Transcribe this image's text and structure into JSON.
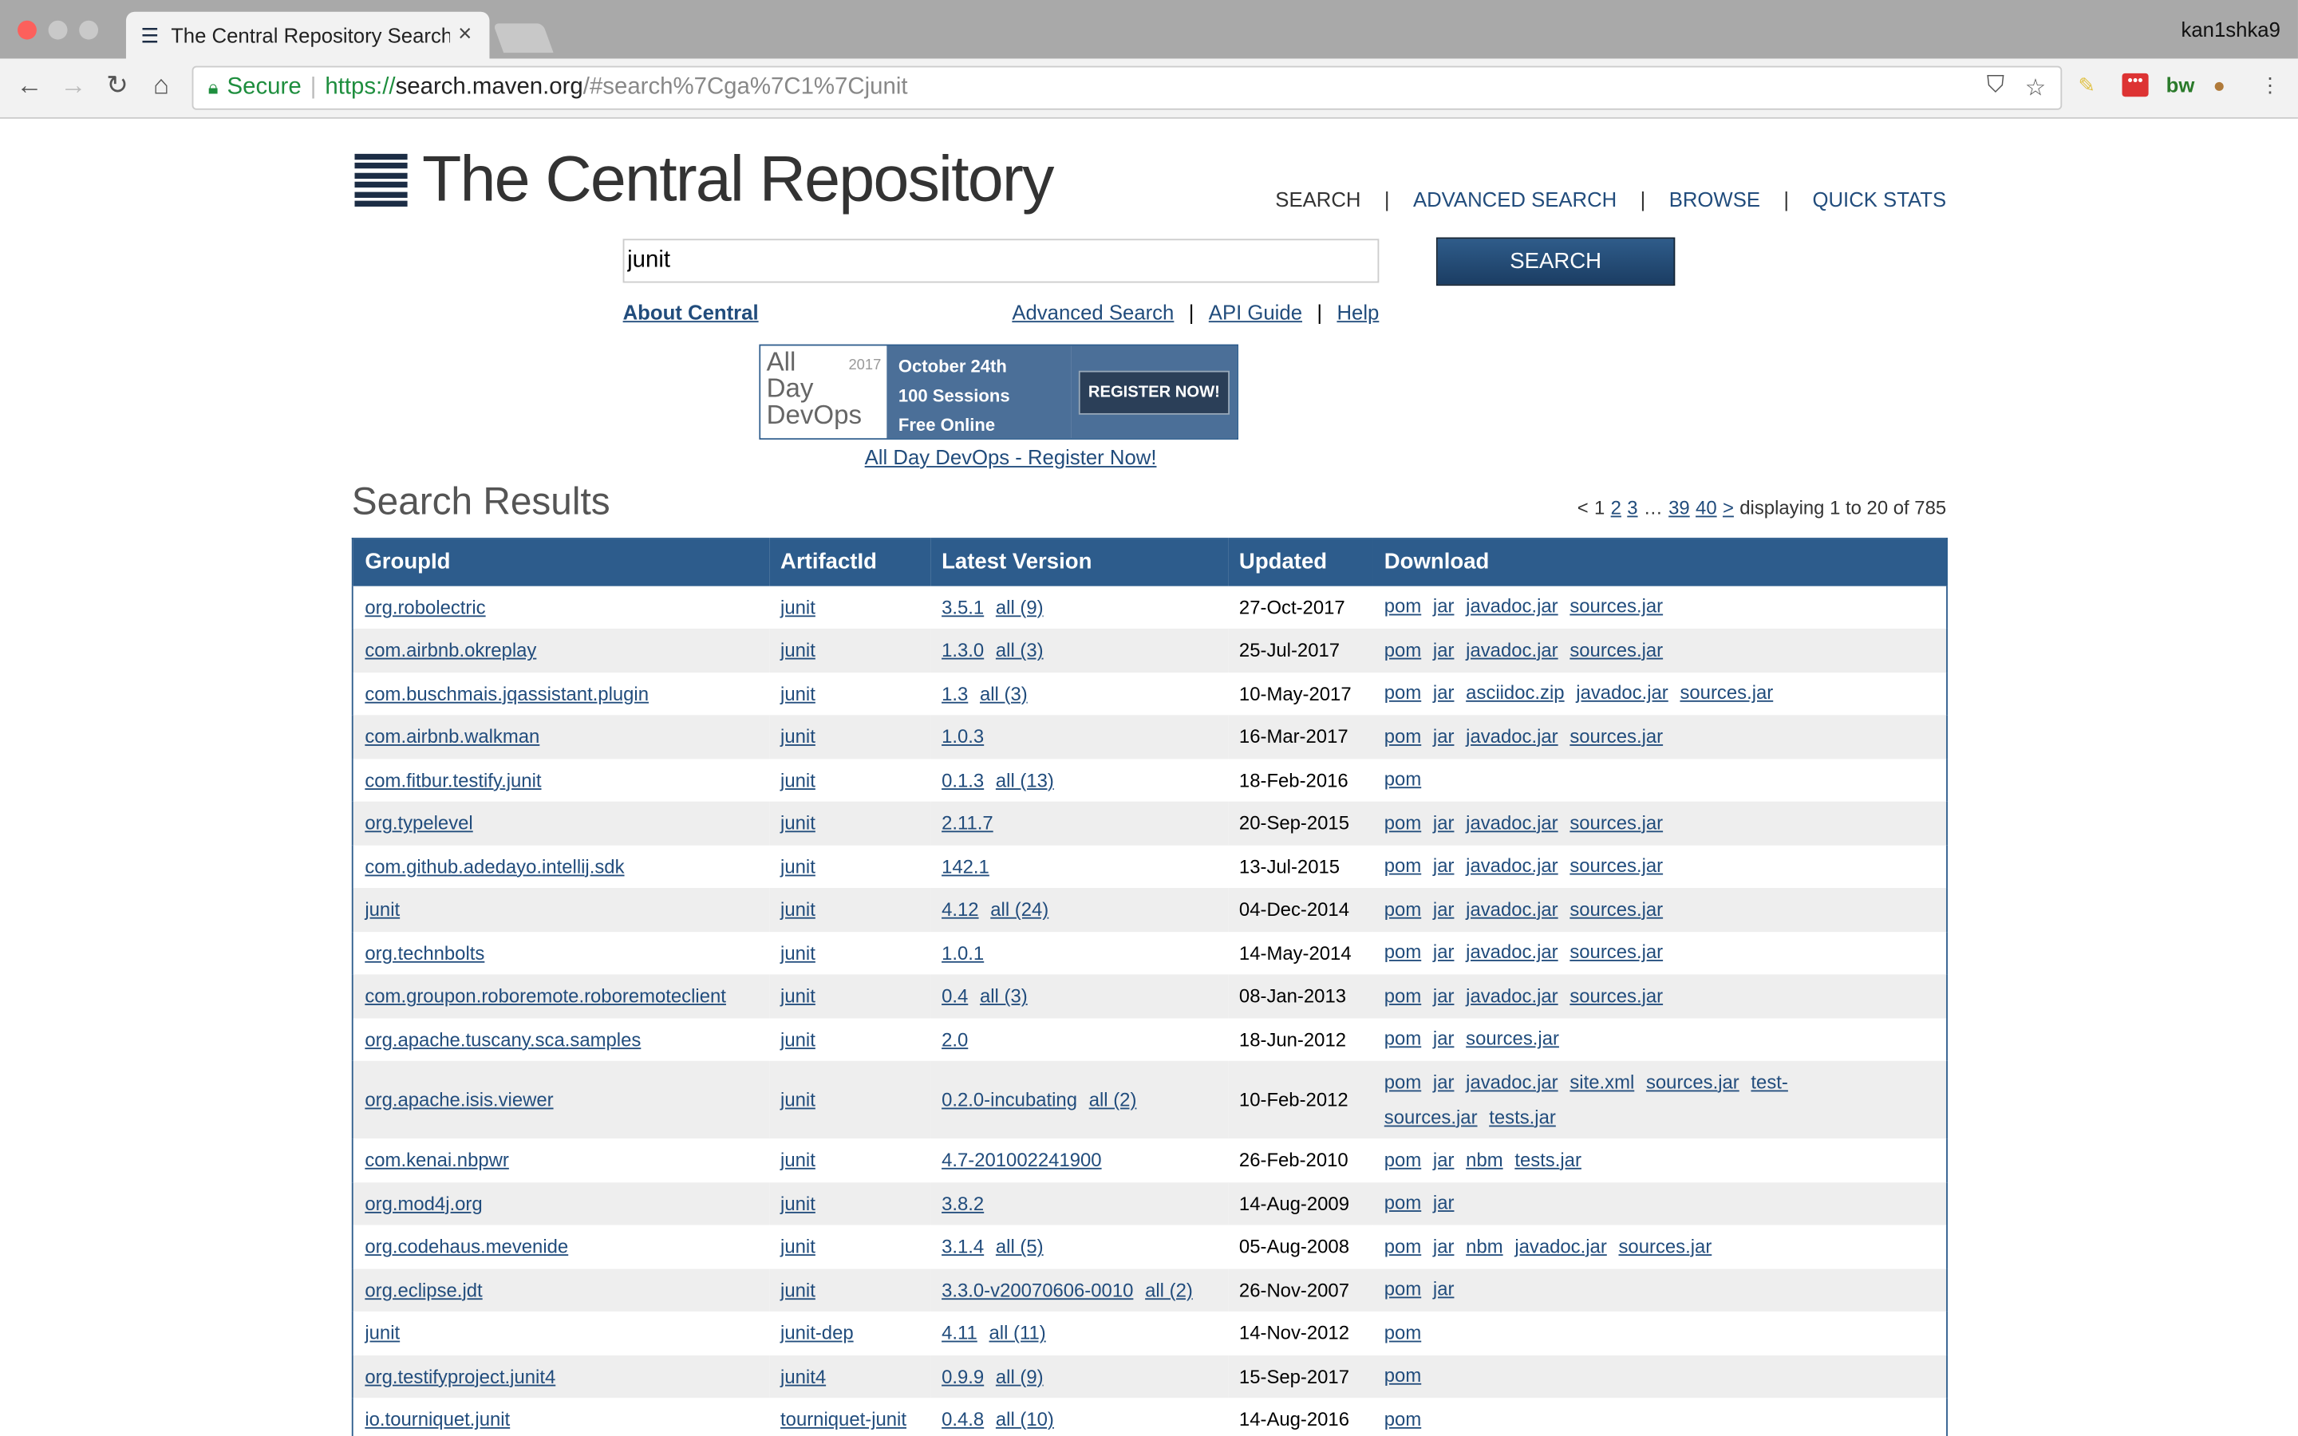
{
  "browser": {
    "tab_title": "The Central Repository Search",
    "profile": "kan1shka9",
    "secure_label": "Secure",
    "url_scheme": "https://",
    "url_host": "search.maven.org",
    "url_path": "/#search%7Cga%7C1%7Cjunit"
  },
  "header": {
    "logo_text": "The Central Repository",
    "nav": [
      "SEARCH",
      "ADVANCED SEARCH",
      "BROWSE",
      "QUICK STATS"
    ]
  },
  "search": {
    "query": "junit",
    "button": "SEARCH",
    "about": "About Central",
    "links": [
      "Advanced Search",
      "API Guide",
      "Help"
    ]
  },
  "banner": {
    "brand_all": "All",
    "brand_day": "Day",
    "brand_devops": "DevOps",
    "year": "2017",
    "line1": "October 24th",
    "line2": "100 Sessions",
    "line3": "Free Online",
    "cta": "REGISTER NOW!",
    "link": "All Day DevOps - Register Now!"
  },
  "results": {
    "title": "Search Results",
    "pager": {
      "prev": "<",
      "current": "1",
      "pages": [
        "2",
        "3"
      ],
      "ellipsis": "…",
      "last_pages": [
        "39",
        "40"
      ],
      "next": ">",
      "summary": "displaying 1 to 20 of 785"
    },
    "columns": [
      "GroupId",
      "ArtifactId",
      "Latest Version",
      "Updated",
      "Download"
    ],
    "rows": [
      {
        "group": "org.robolectric",
        "artifact": "junit",
        "version": "3.5.1",
        "all": "all (9)",
        "updated": "27-Oct-2017",
        "downloads": [
          "pom",
          "jar",
          "javadoc.jar",
          "sources.jar"
        ]
      },
      {
        "group": "com.airbnb.okreplay",
        "artifact": "junit",
        "version": "1.3.0",
        "all": "all (3)",
        "updated": "25-Jul-2017",
        "downloads": [
          "pom",
          "jar",
          "javadoc.jar",
          "sources.jar"
        ]
      },
      {
        "group": "com.buschmais.jqassistant.plugin",
        "artifact": "junit",
        "version": "1.3",
        "all": "all (3)",
        "updated": "10-May-2017",
        "downloads": [
          "pom",
          "jar",
          "asciidoc.zip",
          "javadoc.jar",
          "sources.jar"
        ]
      },
      {
        "group": "com.airbnb.walkman",
        "artifact": "junit",
        "version": "1.0.3",
        "all": "",
        "updated": "16-Mar-2017",
        "downloads": [
          "pom",
          "jar",
          "javadoc.jar",
          "sources.jar"
        ]
      },
      {
        "group": "com.fitbur.testify.junit",
        "artifact": "junit",
        "version": "0.1.3",
        "all": "all (13)",
        "updated": "18-Feb-2016",
        "downloads": [
          "pom"
        ]
      },
      {
        "group": "org.typelevel",
        "artifact": "junit",
        "version": "2.11.7",
        "all": "",
        "updated": "20-Sep-2015",
        "downloads": [
          "pom",
          "jar",
          "javadoc.jar",
          "sources.jar"
        ]
      },
      {
        "group": "com.github.adedayo.intellij.sdk",
        "artifact": "junit",
        "version": "142.1",
        "all": "",
        "updated": "13-Jul-2015",
        "downloads": [
          "pom",
          "jar",
          "javadoc.jar",
          "sources.jar"
        ]
      },
      {
        "group": "junit",
        "artifact": "junit",
        "version": "4.12",
        "all": "all (24)",
        "updated": "04-Dec-2014",
        "downloads": [
          "pom",
          "jar",
          "javadoc.jar",
          "sources.jar"
        ]
      },
      {
        "group": "org.technbolts",
        "artifact": "junit",
        "version": "1.0.1",
        "all": "",
        "updated": "14-May-2014",
        "downloads": [
          "pom",
          "jar",
          "javadoc.jar",
          "sources.jar"
        ]
      },
      {
        "group": "com.groupon.roboremote.roboremoteclient",
        "artifact": "junit",
        "version": "0.4",
        "all": "all (3)",
        "updated": "08-Jan-2013",
        "downloads": [
          "pom",
          "jar",
          "javadoc.jar",
          "sources.jar"
        ]
      },
      {
        "group": "org.apache.tuscany.sca.samples",
        "artifact": "junit",
        "version": "2.0",
        "all": "",
        "updated": "18-Jun-2012",
        "downloads": [
          "pom",
          "jar",
          "sources.jar"
        ]
      },
      {
        "group": "org.apache.isis.viewer",
        "artifact": "junit",
        "version": "0.2.0-incubating",
        "all": "all (2)",
        "updated": "10-Feb-2012",
        "downloads": [
          "pom",
          "jar",
          "javadoc.jar",
          "site.xml",
          "sources.jar",
          "test-sources.jar",
          "tests.jar"
        ],
        "tall": true
      },
      {
        "group": "com.kenai.nbpwr",
        "artifact": "junit",
        "version": "4.7-201002241900",
        "all": "",
        "updated": "26-Feb-2010",
        "downloads": [
          "pom",
          "jar",
          "nbm",
          "tests.jar"
        ]
      },
      {
        "group": "org.mod4j.org",
        "artifact": "junit",
        "version": "3.8.2",
        "all": "",
        "updated": "14-Aug-2009",
        "downloads": [
          "pom",
          "jar"
        ]
      },
      {
        "group": "org.codehaus.mevenide",
        "artifact": "junit",
        "version": "3.1.4",
        "all": "all (5)",
        "updated": "05-Aug-2008",
        "downloads": [
          "pom",
          "jar",
          "nbm",
          "javadoc.jar",
          "sources.jar"
        ]
      },
      {
        "group": "org.eclipse.jdt",
        "artifact": "junit",
        "version": "3.3.0-v20070606-0010",
        "all": "all (2)",
        "updated": "26-Nov-2007",
        "downloads": [
          "pom",
          "jar"
        ]
      },
      {
        "group": "junit",
        "artifact": "junit-dep",
        "version": "4.11",
        "all": "all (11)",
        "updated": "14-Nov-2012",
        "downloads": [
          "pom"
        ]
      },
      {
        "group": "org.testifyproject.junit4",
        "artifact": "junit4",
        "version": "0.9.9",
        "all": "all (9)",
        "updated": "15-Sep-2017",
        "downloads": [
          "pom"
        ]
      },
      {
        "group": "io.tourniquet.junit",
        "artifact": "tourniquet-junit",
        "version": "0.4.8",
        "all": "all (10)",
        "updated": "14-Aug-2016",
        "downloads": [
          "pom"
        ]
      }
    ]
  }
}
